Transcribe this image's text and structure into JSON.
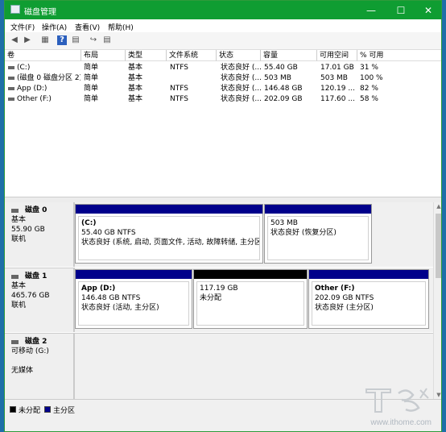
{
  "window": {
    "title": "磁盘管理",
    "minimize": "—",
    "maximize": "☐",
    "close": "✕"
  },
  "menu": [
    "文件(F)",
    "操作(A)",
    "查看(V)",
    "帮助(H)"
  ],
  "toolbar_icons": [
    "back-arrow-icon",
    "forward-arrow-icon",
    "grid-view-icon",
    "help-icon",
    "properties-icon",
    "connect-icon",
    "list-icon"
  ],
  "volume_table": {
    "headers": [
      "卷",
      "布局",
      "类型",
      "文件系统",
      "状态",
      "容量",
      "可用空间",
      "% 可用"
    ],
    "rows": [
      [
        "(C:)",
        "简单",
        "基本",
        "NTFS",
        "状态良好 (...",
        "55.40 GB",
        "17.01 GB",
        "31 %"
      ],
      [
        "(磁盘 0 磁盘分区 2)",
        "简单",
        "基本",
        "",
        "状态良好 (...",
        "503 MB",
        "503 MB",
        "100 %"
      ],
      [
        "App (D:)",
        "简单",
        "基本",
        "NTFS",
        "状态良好 (...",
        "146.48 GB",
        "120.19 ...",
        "82 %"
      ],
      [
        "Other (F:)",
        "简单",
        "基本",
        "NTFS",
        "状态良好 (...",
        "202.09 GB",
        "117.60 ...",
        "58 %"
      ]
    ]
  },
  "disks": [
    {
      "title": "磁盘 0",
      "type": "基本",
      "size": "55.90 GB",
      "status": "联机",
      "partitions": [
        {
          "name": "(C:)",
          "size": "55.40 GB NTFS",
          "status": "状态良好 (系统, 启动, 页面文件, 活动, 故障转储, 主分区)",
          "color": "#00008b"
        },
        {
          "name": "",
          "size": "503 MB",
          "status": "状态良好 (恢复分区)",
          "color": "#00008b"
        }
      ]
    },
    {
      "title": "磁盘 1",
      "type": "基本",
      "size": "465.76 GB",
      "status": "联机",
      "partitions": [
        {
          "name": "App  (D:)",
          "size": "146.48 GB NTFS",
          "status": "状态良好 (活动, 主分区)",
          "color": "#00008b"
        },
        {
          "name": "",
          "size": "117.19 GB",
          "status": "未分配",
          "color": "#000000"
        },
        {
          "name": "Other  (F:)",
          "size": "202.09 GB NTFS",
          "status": "状态良好 (主分区)",
          "color": "#00008b"
        }
      ]
    },
    {
      "title": "磁盘 2",
      "type": "可移动 (G:)",
      "size": "",
      "status": "无媒体",
      "partitions": []
    }
  ],
  "legend": [
    {
      "label": "未分配",
      "color": "#000000"
    },
    {
      "label": "主分区",
      "color": "#00008b"
    }
  ],
  "watermark": {
    "logo_text": "IT之家",
    "url": "www.ithome.com"
  }
}
